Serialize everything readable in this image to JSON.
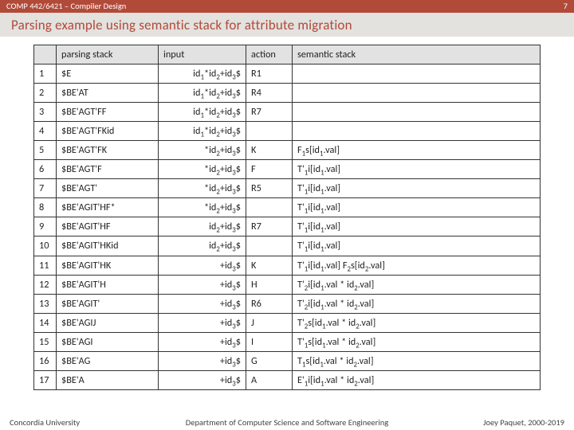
{
  "header": {
    "course": "COMP 442/6421 – Compiler Design",
    "page": "7"
  },
  "title": "Parsing example using semantic stack for attribute migration",
  "columns": {
    "num": "",
    "stack": "parsing stack",
    "input": "input",
    "action": "action",
    "sem": "semantic stack"
  },
  "rows": [
    {
      "n": "1",
      "stack": "$E",
      "input": "id_1*id_2+id_3$",
      "action": "R1",
      "sem": ""
    },
    {
      "n": "2",
      "stack": "$BE'AT",
      "input": "id_1*id_2+id_3$",
      "action": "R4",
      "sem": ""
    },
    {
      "n": "3",
      "stack": "$BE'AGT'FF",
      "input": "id_1*id_2+id_3$",
      "action": "R7",
      "sem": ""
    },
    {
      "n": "4",
      "stack": "$BE'AGT'FKid",
      "input": "id_1*id_2+id_3$",
      "action": "",
      "sem": ""
    },
    {
      "n": "5",
      "stack": "$BE'AGT'FK",
      "input": "*id_2+id_3$",
      "action": "K",
      "sem": "F_1s[id_1.val]"
    },
    {
      "n": "6",
      "stack": "$BE'AGT'F",
      "input": "*id_2+id_3$",
      "action": "F",
      "sem": "T'_1i[id_1.val]"
    },
    {
      "n": "7",
      "stack": "$BE'AGT'",
      "input": "*id_2+id_3$",
      "action": "R5",
      "sem": "T'_1i[id_1.val]"
    },
    {
      "n": "8",
      "stack": "$BE'AGIT'HF*",
      "input": "*id_2+id_3$",
      "action": "",
      "sem": "T'_1i[id_1.val]"
    },
    {
      "n": "9",
      "stack": "$BE'AGIT'HF",
      "input": "id_2+id_3$",
      "action": "R7",
      "sem": "T'_1i[id_1.val]"
    },
    {
      "n": "10",
      "stack": "$BE'AGIT'HKid",
      "input": "id_2+id_3$",
      "action": "",
      "sem": "T'_1i[id_1.val]"
    },
    {
      "n": "11",
      "stack": "$BE'AGIT'HK",
      "input": "+id_3$",
      "action": "K",
      "sem": "T'_1i[id_1.val] F_2s[id_2.val]"
    },
    {
      "n": "12",
      "stack": "$BE'AGIT'H",
      "input": "+id_3$",
      "action": "H",
      "sem": "T'_2i[id_1.val * id_2.val]"
    },
    {
      "n": "13",
      "stack": "$BE'AGIT'",
      "input": "+id_3$",
      "action": "R6",
      "sem": "T'_2i[id_1.val * id_2.val]"
    },
    {
      "n": "14",
      "stack": "$BE'AGIJ",
      "input": "+id_3$",
      "action": "J",
      "sem": "T'_2s[id_1.val * id_2.val]"
    },
    {
      "n": "15",
      "stack": "$BE'AGI",
      "input": "+id_3$",
      "action": "I",
      "sem": "T'_1s[id_1.val * id_2.val]"
    },
    {
      "n": "16",
      "stack": "$BE'AG",
      "input": "+id_3$",
      "action": "G",
      "sem": "T_1s[id_1.val * id_2.val]"
    },
    {
      "n": "17",
      "stack": "$BE'A",
      "input": "+id_3$",
      "action": "A",
      "sem": "E'_1i[id_1.val * id_2.val]"
    }
  ],
  "footer": {
    "left": "Concordia University",
    "mid": "Department of Computer Science and Software Engineering",
    "right": "Joey Paquet, 2000-2019"
  }
}
